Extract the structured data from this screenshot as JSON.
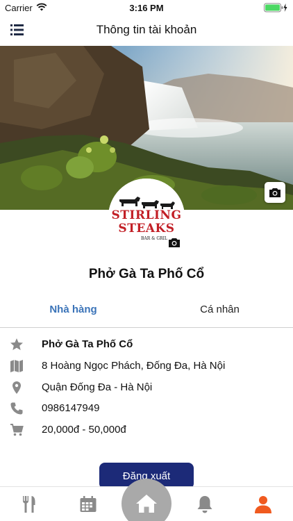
{
  "status_bar": {
    "carrier": "Carrier",
    "time": "3:16 PM",
    "icons": [
      "wifi-icon",
      "battery-icon",
      "charging-bolt-icon"
    ]
  },
  "header": {
    "title": "Thông tin tài khoản",
    "menu_icon": "list-menu-icon"
  },
  "cover": {
    "image": "waterfall-landscape-photo",
    "camera_icon": "camera-icon"
  },
  "avatar": {
    "logo_lines": [
      "STIRLING",
      "STEAKS",
      "BAR & GRILL"
    ],
    "camera_icon": "camera-icon"
  },
  "restaurant_name": "Phở Gà Ta Phố Cổ",
  "tabs": [
    {
      "label": "Nhà hàng",
      "active": true
    },
    {
      "label": "Cá nhân",
      "active": false
    }
  ],
  "info": {
    "name": {
      "icon": "star-icon",
      "text": "Phở Gà Ta Phố Cổ"
    },
    "address": {
      "icon": "map-icon",
      "text": "8 Hoàng Ngọc Phách, Đống Đa, Hà Nội"
    },
    "district": {
      "icon": "location-pin-icon",
      "text": "Quận Đống Đa - Hà Nội"
    },
    "phone": {
      "icon": "phone-icon",
      "text": "0986147949"
    },
    "price": {
      "icon": "cart-icon",
      "text": "20,000đ - 50,000đ"
    }
  },
  "logout_label": "Đăng xuất",
  "bottom_nav": [
    "fork-knife-icon",
    "calendar-icon",
    "home-icon",
    "bell-icon",
    "user-icon"
  ],
  "colors": {
    "active_tab": "#3a73b8",
    "logout_button": "#1c2a78",
    "icon_gray": "#8a8a8a",
    "user_active": "#f05a1f",
    "home_fab": "#a9a9a9",
    "battery": "#4cd964"
  }
}
